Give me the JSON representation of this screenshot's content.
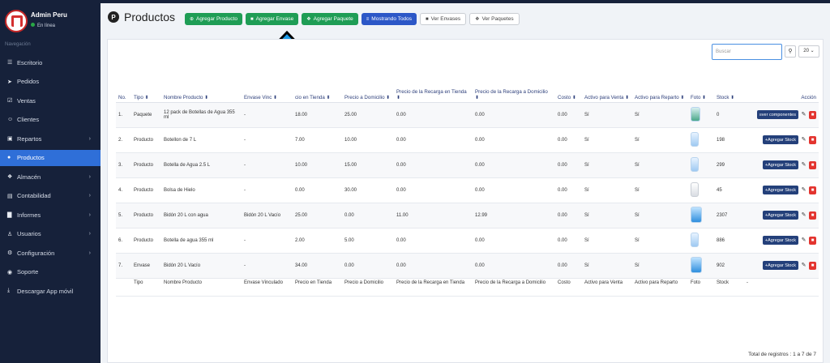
{
  "sidebar": {
    "user_name": "Admin Peru",
    "user_status": "En línea",
    "nav_header": "Navegación",
    "items": [
      {
        "label": "Escritorio",
        "icon": "dashboard-icon",
        "glyph": "☰",
        "chevron": false,
        "active": false
      },
      {
        "label": "Pedidos",
        "icon": "send-icon",
        "glyph": "➤",
        "chevron": false,
        "active": false
      },
      {
        "label": "Ventas",
        "icon": "check-square-icon",
        "glyph": "☑",
        "chevron": false,
        "active": false
      },
      {
        "label": "Clientes",
        "icon": "users-icon",
        "glyph": "☺",
        "chevron": false,
        "active": false
      },
      {
        "label": "Repartos",
        "icon": "truck-icon",
        "glyph": "▣",
        "chevron": true,
        "active": false
      },
      {
        "label": "Productos",
        "icon": "product-icon",
        "glyph": "●",
        "chevron": false,
        "active": true
      },
      {
        "label": "Almacén",
        "icon": "warehouse-icon",
        "glyph": "❖",
        "chevron": true,
        "active": false
      },
      {
        "label": "Contabilidad",
        "icon": "accounting-icon",
        "glyph": "▤",
        "chevron": true,
        "active": false
      },
      {
        "label": "Informes",
        "icon": "chart-icon",
        "glyph": "▇",
        "chevron": true,
        "active": false
      },
      {
        "label": "Usuarios",
        "icon": "user-icon",
        "glyph": "♙",
        "chevron": true,
        "active": false
      },
      {
        "label": "Configuración",
        "icon": "cogs-icon",
        "glyph": "⚙",
        "chevron": true,
        "active": false
      },
      {
        "label": "Soporte",
        "icon": "help-icon",
        "glyph": "◉",
        "chevron": false,
        "active": false
      },
      {
        "label": "Descargar App móvil",
        "icon": "download-icon",
        "glyph": "⤓",
        "chevron": false,
        "active": false
      }
    ]
  },
  "header": {
    "title": "Productos",
    "title_icon": "P",
    "buttons": [
      {
        "label": "Agregar Producto",
        "style": "green",
        "icon": "plus-circle-icon",
        "glyph": "⊕"
      },
      {
        "label": "Agregar Envase",
        "style": "green",
        "icon": "box-icon",
        "glyph": "■"
      },
      {
        "label": "Agregar Paquete",
        "style": "green",
        "icon": "boxes-icon",
        "glyph": "❖"
      },
      {
        "label": "Mostrando Todos",
        "style": "blue",
        "icon": "list-icon",
        "glyph": "≡"
      },
      {
        "label": "Ver Envases",
        "style": "light",
        "icon": "box-icon",
        "glyph": "■"
      },
      {
        "label": "Ver Paquetes",
        "style": "light",
        "icon": "boxes-icon",
        "glyph": "❖"
      }
    ]
  },
  "search": {
    "placeholder": "Buscar",
    "page_size": "20"
  },
  "table": {
    "columns": [
      "No.",
      "Tipo",
      "Nombre Producto",
      "Envase Vinculado",
      "Precio en Tienda",
      "Precio a Domicilio",
      "Precio de la Recarga en Tienda",
      "Precio de la Recarga a Domicilio",
      "Costo",
      "Activo para Venta",
      "Activo para Reparto",
      "Foto",
      "Stock",
      "Acción"
    ],
    "header_display": [
      "No.",
      "Tipo",
      "Nombre Producto",
      "Envase Vinc",
      "cio en Tienda",
      "Precio a Domicilio",
      "Precio de la Recarga en Tienda",
      "Precio de la Recarga a Domicilio",
      "Costo",
      "Activo para Venta",
      "Activo para Reparto",
      "Foto",
      "Stock",
      "Acción"
    ],
    "rows": [
      {
        "no": "1.",
        "tipo": "Paquete",
        "nombre": "12 pack de Botellas de Agua 355 ml",
        "envase": "-",
        "tienda": "18.00",
        "domicilio": "25.00",
        "recarga_tienda": "0.00",
        "recarga_domicilio": "0.00",
        "costo": "0.00",
        "venta": "Sí",
        "reparto": "Sí",
        "foto": "pack",
        "stock": "0",
        "accion": "ver componentes"
      },
      {
        "no": "2.",
        "tipo": "Producto",
        "nombre": "Botellon de 7 L",
        "envase": "-",
        "tienda": "7.00",
        "domicilio": "10.00",
        "recarga_tienda": "0.00",
        "recarga_domicilio": "0.00",
        "costo": "0.00",
        "venta": "Sí",
        "reparto": "Sí",
        "foto": "bottle",
        "stock": "198",
        "accion": "Agregar Stock"
      },
      {
        "no": "3.",
        "tipo": "Producto",
        "nombre": "Botella de Agua 2.5 L",
        "envase": "-",
        "tienda": "10.00",
        "domicilio": "15.00",
        "recarga_tienda": "0.00",
        "recarga_domicilio": "0.00",
        "costo": "0.00",
        "venta": "Sí",
        "reparto": "Sí",
        "foto": "bottle",
        "stock": "299",
        "accion": "Agregar Stock"
      },
      {
        "no": "4.",
        "tipo": "Producto",
        "nombre": "Bolsa de Hielo",
        "envase": "-",
        "tienda": "0.00",
        "domicilio": "30.00",
        "recarga_tienda": "0.00",
        "recarga_domicilio": "0.00",
        "costo": "0.00",
        "venta": "Sí",
        "reparto": "Sí",
        "foto": "bag",
        "stock": "45",
        "accion": "Agregar Stock"
      },
      {
        "no": "5.",
        "tipo": "Producto",
        "nombre": "Bidón 20 L con agua",
        "envase": "Bidón 20 L Vacío",
        "tienda": "25.00",
        "domicilio": "0.00",
        "recarga_tienda": "11.00",
        "recarga_domicilio": "12.99",
        "costo": "0.00",
        "venta": "Sí",
        "reparto": "Sí",
        "foto": "jug",
        "stock": "2307",
        "accion": "Agregar Stock"
      },
      {
        "no": "6.",
        "tipo": "Producto",
        "nombre": "Botella de agua 355 ml",
        "envase": "-",
        "tienda": "2.00",
        "domicilio": "5.00",
        "recarga_tienda": "0.00",
        "recarga_domicilio": "0.00",
        "costo": "0.00",
        "venta": "Sí",
        "reparto": "Sí",
        "foto": "bottle",
        "stock": "886",
        "accion": "Agregar Stock"
      },
      {
        "no": "7.",
        "tipo": "Envase",
        "nombre": "Bidón 20 L Vacío",
        "envase": "-",
        "tienda": "34.00",
        "domicilio": "0.00",
        "recarga_tienda": "0.00",
        "recarga_domicilio": "0.00",
        "costo": "0.00",
        "venta": "Sí",
        "reparto": "Sí",
        "foto": "jug",
        "stock": "902",
        "accion": "Agregar Stock"
      }
    ],
    "footer": [
      "",
      "Tipo",
      "Nombre Producto",
      "Envase Vinculado",
      "Precio en Tienda",
      "Precio a Domicilio",
      "Precio de la Recarga en Tienda",
      "Precio de la Recarga a Domicilio",
      "Costo",
      "Activo para Venta",
      "Activo para Reparto",
      "Foto",
      "Stock",
      "-"
    ],
    "sortable": [
      false,
      true,
      true,
      true,
      true,
      true,
      true,
      true,
      true,
      true,
      true,
      true,
      true,
      false
    ]
  },
  "total_text": "Total de registros : 1 a 7 de 7",
  "colors": {
    "sidebar": "#16213a",
    "active": "#2f6fd8",
    "green": "#1f9d55",
    "blue": "#2c57c7",
    "danger": "#e3342f",
    "action": "#24407a",
    "arrow": "#1e9be8"
  }
}
